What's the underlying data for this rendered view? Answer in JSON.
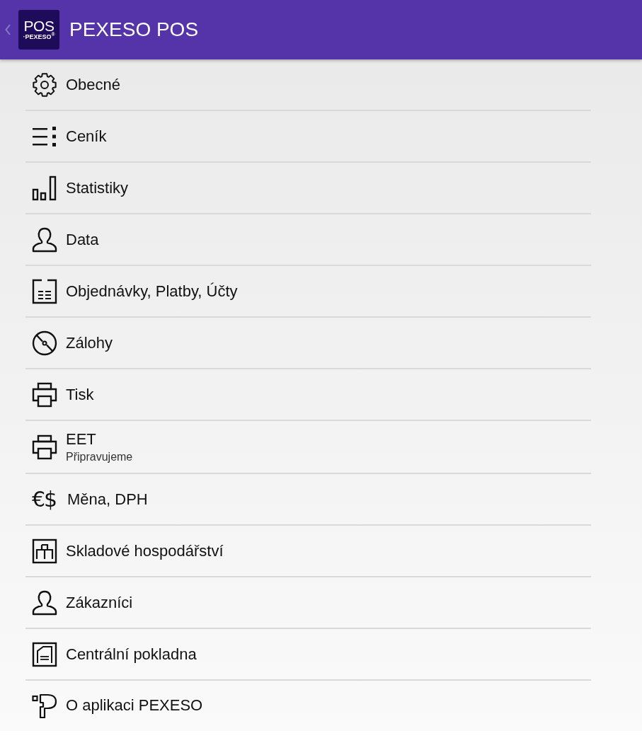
{
  "app_bar": {
    "logo": {
      "top": "POS",
      "bottom": "·PEXESO$^{®}$"
    },
    "title": "PEXESO POS"
  },
  "menu": {
    "items": [
      {
        "kind": "gear",
        "label": "Obecné"
      },
      {
        "kind": "list",
        "label": "Ceník"
      },
      {
        "kind": "bars",
        "label": "Statistiky"
      },
      {
        "kind": "person",
        "label": "Data"
      },
      {
        "kind": "document",
        "label": "Objednávky, Platby, Účty"
      },
      {
        "kind": "disc",
        "label": "Zálohy"
      },
      {
        "kind": "printer",
        "label": "Tisk"
      },
      {
        "kind": "printer",
        "label": "EET",
        "subtitle": "Připravujeme"
      },
      {
        "kind": "glyph",
        "icon_glyph": "€$",
        "label": "Měna, DPH"
      },
      {
        "kind": "warehouse",
        "label": "Skladové hospodářství"
      },
      {
        "kind": "person",
        "label": "Zákazníci"
      },
      {
        "kind": "building",
        "label": "Centrální pokladna"
      },
      {
        "kind": "logo",
        "label": "O aplikaci PEXESO"
      }
    ]
  }
}
